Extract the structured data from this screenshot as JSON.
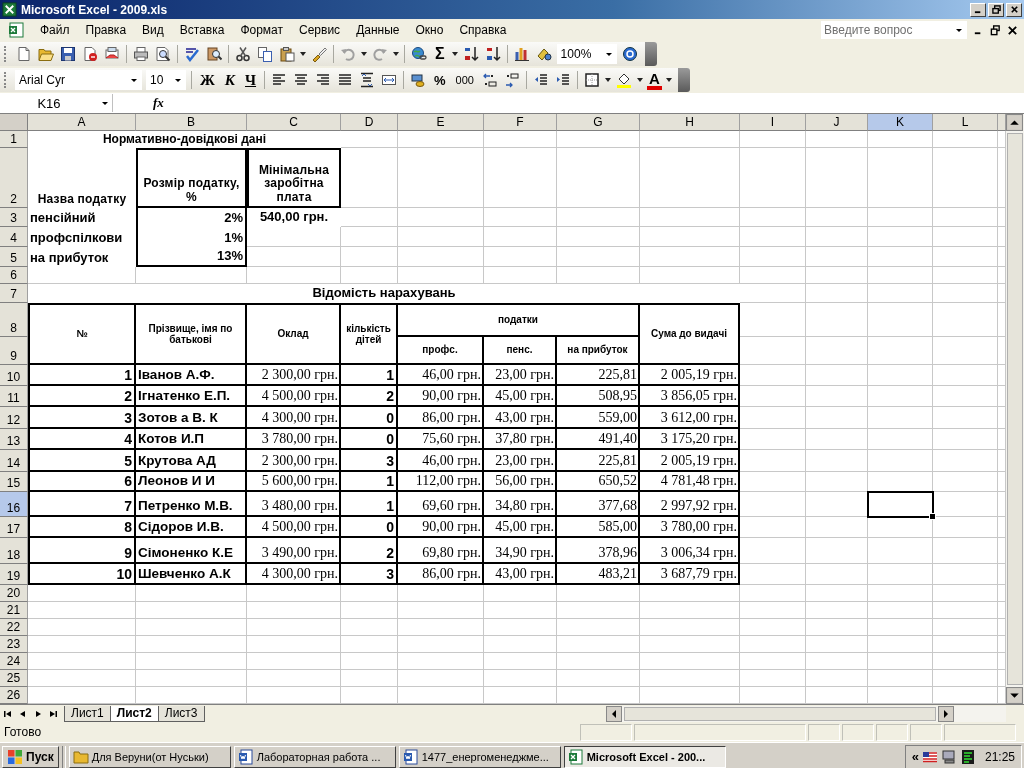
{
  "window": {
    "title": "Microsoft Excel - 2009.xls"
  },
  "menu": {
    "items": [
      "Файл",
      "Правка",
      "Вид",
      "Вставка",
      "Формат",
      "Сервис",
      "Данные",
      "Окно",
      "Справка"
    ],
    "help_search": {
      "placeholder": "Введите вопрос"
    }
  },
  "standard_toolbar": {
    "autosum": "Σ",
    "zoom": "100%"
  },
  "formatting_toolbar": {
    "font": "Arial Cyr",
    "size": "10",
    "bold": "Ж",
    "italic": "К",
    "underline": "Ч",
    "percent": "%",
    "thousands": "000",
    "font_color": "A"
  },
  "formula_bar": {
    "name_box": "K16",
    "function_label": "fx"
  },
  "sheet": {
    "columns": [
      {
        "label": "A",
        "selected": false
      },
      {
        "label": "B",
        "selected": false
      },
      {
        "label": "C",
        "selected": false
      },
      {
        "label": "D",
        "selected": false
      },
      {
        "label": "E",
        "selected": false
      },
      {
        "label": "F",
        "selected": false
      },
      {
        "label": "G",
        "selected": false
      },
      {
        "label": "H",
        "selected": false
      },
      {
        "label": "I",
        "selected": false
      },
      {
        "label": "J",
        "selected": false
      },
      {
        "label": "K",
        "selected": true
      },
      {
        "label": "L",
        "selected": false
      }
    ],
    "rows": [
      {
        "label": "1",
        "selected": false
      },
      {
        "label": "2",
        "selected": false
      },
      {
        "label": "3",
        "selected": false
      },
      {
        "label": "4",
        "selected": false
      },
      {
        "label": "5",
        "selected": false
      },
      {
        "label": "6",
        "selected": false
      },
      {
        "label": "7",
        "selected": false
      },
      {
        "label": "8",
        "selected": false
      },
      {
        "label": "9",
        "selected": false
      },
      {
        "label": "10",
        "selected": false
      },
      {
        "label": "11",
        "selected": false
      },
      {
        "label": "12",
        "selected": false
      },
      {
        "label": "13",
        "selected": false
      },
      {
        "label": "14",
        "selected": false
      },
      {
        "label": "15",
        "selected": false
      },
      {
        "label": "16",
        "selected": true
      },
      {
        "label": "17",
        "selected": false
      },
      {
        "label": "18",
        "selected": false
      },
      {
        "label": "19",
        "selected": false
      },
      {
        "label": "20",
        "selected": false
      },
      {
        "label": "21",
        "selected": false
      },
      {
        "label": "22",
        "selected": false
      },
      {
        "label": "23",
        "selected": false
      },
      {
        "label": "24",
        "selected": false
      },
      {
        "label": "25",
        "selected": false
      },
      {
        "label": "26",
        "selected": false
      }
    ]
  },
  "reference_table": {
    "title": "Нормативно-довідкові дані",
    "headers": [
      "Назва податку",
      "Розмір податку, %",
      "Мінімальна заробітна плата"
    ],
    "rows": [
      {
        "name": "пенсійний",
        "rate": "2%"
      },
      {
        "name": "профспілкови",
        "rate": "1%"
      },
      {
        "name": "на прибуток",
        "rate": "13%"
      }
    ],
    "minimum_wage": "540,00 грн."
  },
  "payroll_table": {
    "title": "Відомість нарахувань",
    "headers": {
      "number": "№",
      "name": "Прізвище, імя по батькові",
      "salary": "Оклад",
      "children": "кількість дітей",
      "taxes": "податки",
      "union": "профс.",
      "pension": "пенс.",
      "income": "на прибуток",
      "total": "Сума до видачі"
    },
    "rows": [
      {
        "number": "1",
        "name": "Іванов А.Ф.",
        "salary": "2 300,00 грн.",
        "children": "1",
        "union": "46,00 грн.",
        "pension": "23,00 грн.",
        "income": "225,81",
        "total": "2 005,19 грн."
      },
      {
        "number": "2",
        "name": "Ігнатенко Е.П.",
        "salary": "4 500,00 грн.",
        "children": "2",
        "union": "90,00 грн.",
        "pension": "45,00 грн.",
        "income": "508,95",
        "total": "3 856,05 грн."
      },
      {
        "number": "3",
        "name": "Зотов а В. К",
        "salary": "4 300,00 грн.",
        "children": "0",
        "union": "86,00 грн.",
        "pension": "43,00 грн.",
        "income": "559,00",
        "total": "3 612,00 грн."
      },
      {
        "number": "4",
        "name": "Котов И.П",
        "salary": "3 780,00 грн.",
        "children": "0",
        "union": "75,60 грн.",
        "pension": "37,80 грн.",
        "income": "491,40",
        "total": "3 175,20 грн."
      },
      {
        "number": "5",
        "name": "Крутова АД",
        "salary": "2 300,00 грн.",
        "children": "3",
        "union": "46,00 грн.",
        "pension": "23,00 грн.",
        "income": "225,81",
        "total": "2 005,19 грн."
      },
      {
        "number": "6",
        "name": "Леонов И И",
        "salary": "5 600,00 грн.",
        "children": "1",
        "union": "112,00 грн.",
        "pension": "56,00 грн.",
        "income": "650,52",
        "total": "4 781,48 грн."
      },
      {
        "number": "7",
        "name": "Петренко М.В.",
        "salary": "3 480,00 грн.",
        "children": "1",
        "union": "69,60 грн.",
        "pension": "34,80 грн.",
        "income": "377,68",
        "total": "2 997,92 грн."
      },
      {
        "number": "8",
        "name": "Сідоров И.В.",
        "salary": "4 500,00 грн.",
        "children": "0",
        "union": "90,00 грн.",
        "pension": "45,00 грн.",
        "income": "585,00",
        "total": "3 780,00 грн."
      },
      {
        "number": "9",
        "name": "Сімоненко К.Е",
        "salary": "3 490,00 грн.",
        "children": "2",
        "union": "69,80 грн.",
        "pension": "34,90 грн.",
        "income": "378,96",
        "total": "3 006,34 грн."
      },
      {
        "number": "10",
        "name": "Шевченко А.К",
        "salary": "4 300,00 грн.",
        "children": "3",
        "union": "86,00 грн.",
        "pension": "43,00 грн.",
        "income": "483,21",
        "total": "3 687,79 грн."
      }
    ]
  },
  "sheet_tabs": [
    {
      "label": "Лист1",
      "selected": false
    },
    {
      "label": "Лист2",
      "selected": true
    },
    {
      "label": "Лист3",
      "selected": false
    }
  ],
  "status_bar": {
    "text": "Готово"
  },
  "taskbar": {
    "start": "Пуск",
    "tasks": [
      {
        "label": "Для Веруни(от Нуськи)",
        "kind": "folder",
        "selected": false
      },
      {
        "label": "Лабораторная работа ...",
        "kind": "document",
        "selected": false
      },
      {
        "label": "1477_енергоменеджме...",
        "kind": "document",
        "selected": false
      },
      {
        "label": "Microsoft Excel - 200...",
        "kind": "spreadsheet",
        "selected": true
      }
    ],
    "tray_expand": "«",
    "clock": "21:25"
  }
}
